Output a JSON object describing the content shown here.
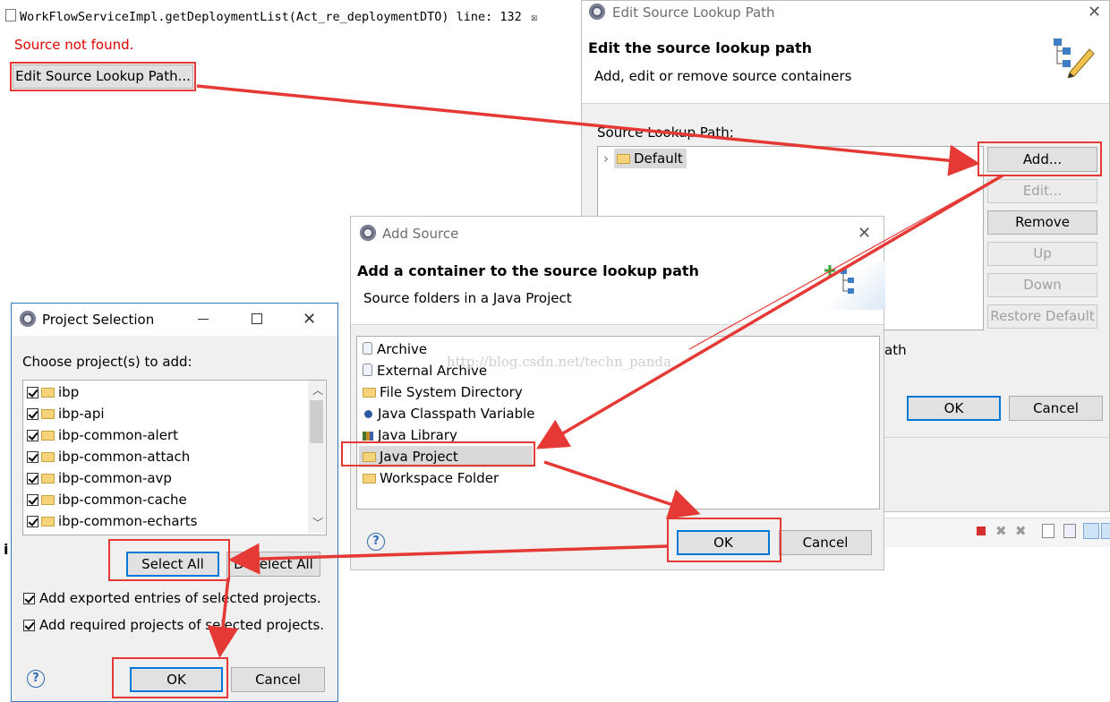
{
  "editor": {
    "tab_title": "WorkFlowServiceImpl.getDeploymentList(Act_re_deploymentDTO) line: 132",
    "tab_close": "☒",
    "source_not_found": "Source not found.",
    "edit_button": "Edit Source Lookup Path..."
  },
  "edit_dialog": {
    "title": "Edit Source Lookup Path",
    "header": "Edit the source lookup path",
    "subheader": "Add, edit or remove source containers",
    "list_label": "Source Lookup Path:",
    "tree_item": "Default",
    "buttons": {
      "add": "Add...",
      "edit": "Edit...",
      "remove": "Remove",
      "up": "Up",
      "down": "Down",
      "restore": "Restore Default"
    },
    "partial_label": "ath",
    "ok": "OK",
    "cancel": "Cancel"
  },
  "add_source": {
    "title": "Add Source",
    "header": "Add a container to the source lookup path",
    "subheader": "Source folders in a Java Project",
    "items": [
      {
        "label": "Archive",
        "icon": "archive-icon"
      },
      {
        "label": "External Archive",
        "icon": "external-archive-icon"
      },
      {
        "label": "File System Directory",
        "icon": "folder-icon"
      },
      {
        "label": "Java Classpath Variable",
        "icon": "variable-icon"
      },
      {
        "label": "Java Library",
        "icon": "library-icon"
      },
      {
        "label": "Java Project",
        "icon": "project-icon"
      },
      {
        "label": "Workspace Folder",
        "icon": "folder-icon"
      }
    ],
    "ok": "OK",
    "cancel": "Cancel",
    "help": "?"
  },
  "project_selection": {
    "title": "Project Selection",
    "label": "Choose project(s) to add:",
    "projects": [
      "ibp",
      "ibp-api",
      "ibp-common-alert",
      "ibp-common-attach",
      "ibp-common-avp",
      "ibp-common-cache",
      "ibp-common-echarts"
    ],
    "select_all": "Select All",
    "deselect_all": "Deselect All",
    "option1": "Add exported entries of selected projects.",
    "option2": "Add required projects of selected projects.",
    "ok": "OK",
    "cancel": "Cancel",
    "help": "?"
  },
  "watermark": "http://blog.csdn.net/techn_panda",
  "background_fragments": {
    "left_char": "i"
  },
  "colors": {
    "annotation": "#e53935",
    "selection": "#d9d9d9",
    "error_text": "#e00000"
  }
}
